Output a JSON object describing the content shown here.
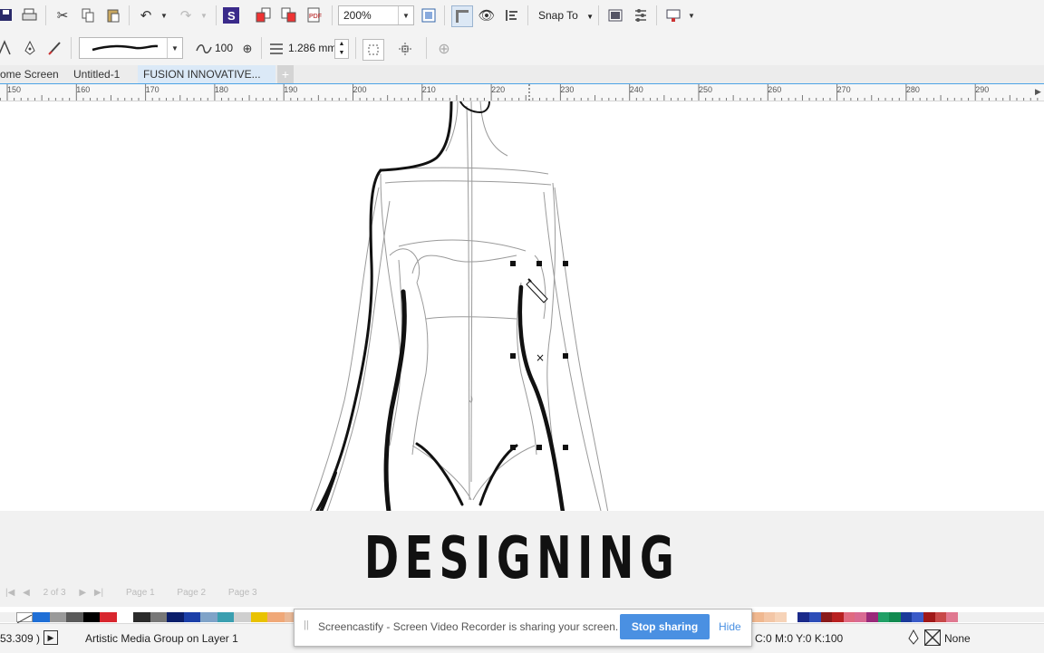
{
  "toolbar": {
    "zoom_value": "200%",
    "snap_to_label": "Snap To",
    "icons": [
      "save-icon",
      "print-icon",
      "cut-icon",
      "copy-icon",
      "paste-icon",
      "undo-icon",
      "redo-icon",
      "app-launcher-icon",
      "import-icon",
      "export-icon",
      "publish-pdf-icon",
      "full-screen-icon",
      "show-rulers-icon",
      "view-icon",
      "align-icon",
      "options-icon",
      "launch-icon"
    ]
  },
  "property_bar": {
    "smoothing_value": "100",
    "width_value": "1.286 mm"
  },
  "tabs": [
    {
      "label": "ome Screen"
    },
    {
      "label": "Untitled-1"
    },
    {
      "label": "FUSION INNOVATIVE..."
    }
  ],
  "ruler": {
    "labels": [
      "150",
      "160",
      "170",
      "180",
      "190",
      "200",
      "210",
      "220",
      "230",
      "240",
      "250",
      "260",
      "270",
      "280",
      "290"
    ]
  },
  "banner": {
    "title": "DESIGNING"
  },
  "page_nav": {
    "page_count": "2 of 3",
    "pages": [
      "Page 1",
      "Page 2",
      "Page 3"
    ]
  },
  "palette_colors": [
    "#1f6fd6",
    "#9a9a9a",
    "#5a5a5a",
    "#000000",
    "#d8262e",
    "#ffffff",
    "#2b2b2b",
    "#777777",
    "#0b1e6b",
    "#1b3fa8",
    "#7fa3c8",
    "#3a9fb0",
    "#cfcfcf",
    "#e9c200",
    "#f0a878",
    "#e9b896",
    "#f5c9a8",
    "#b8d7e8",
    "#5d5d8a",
    "#b03a7a",
    "#11a05e",
    "#1a2a8a",
    "#2a4ab0",
    "#8a1a1a",
    "#b82020",
    "#e05a78",
    "#d46a9a"
  ],
  "status": {
    "coordinates": "53.309 )",
    "object_info": "Artistic Media Group on Layer 1",
    "fill_info": "C:0 M:0 Y:0 K:100",
    "outline_info": "None"
  },
  "screencastify": {
    "message": "Screencastify - Screen Video Recorder is sharing your screen.",
    "stop_label": "Stop sharing",
    "hide_label": "Hide",
    "accent": "#4a90e2"
  }
}
